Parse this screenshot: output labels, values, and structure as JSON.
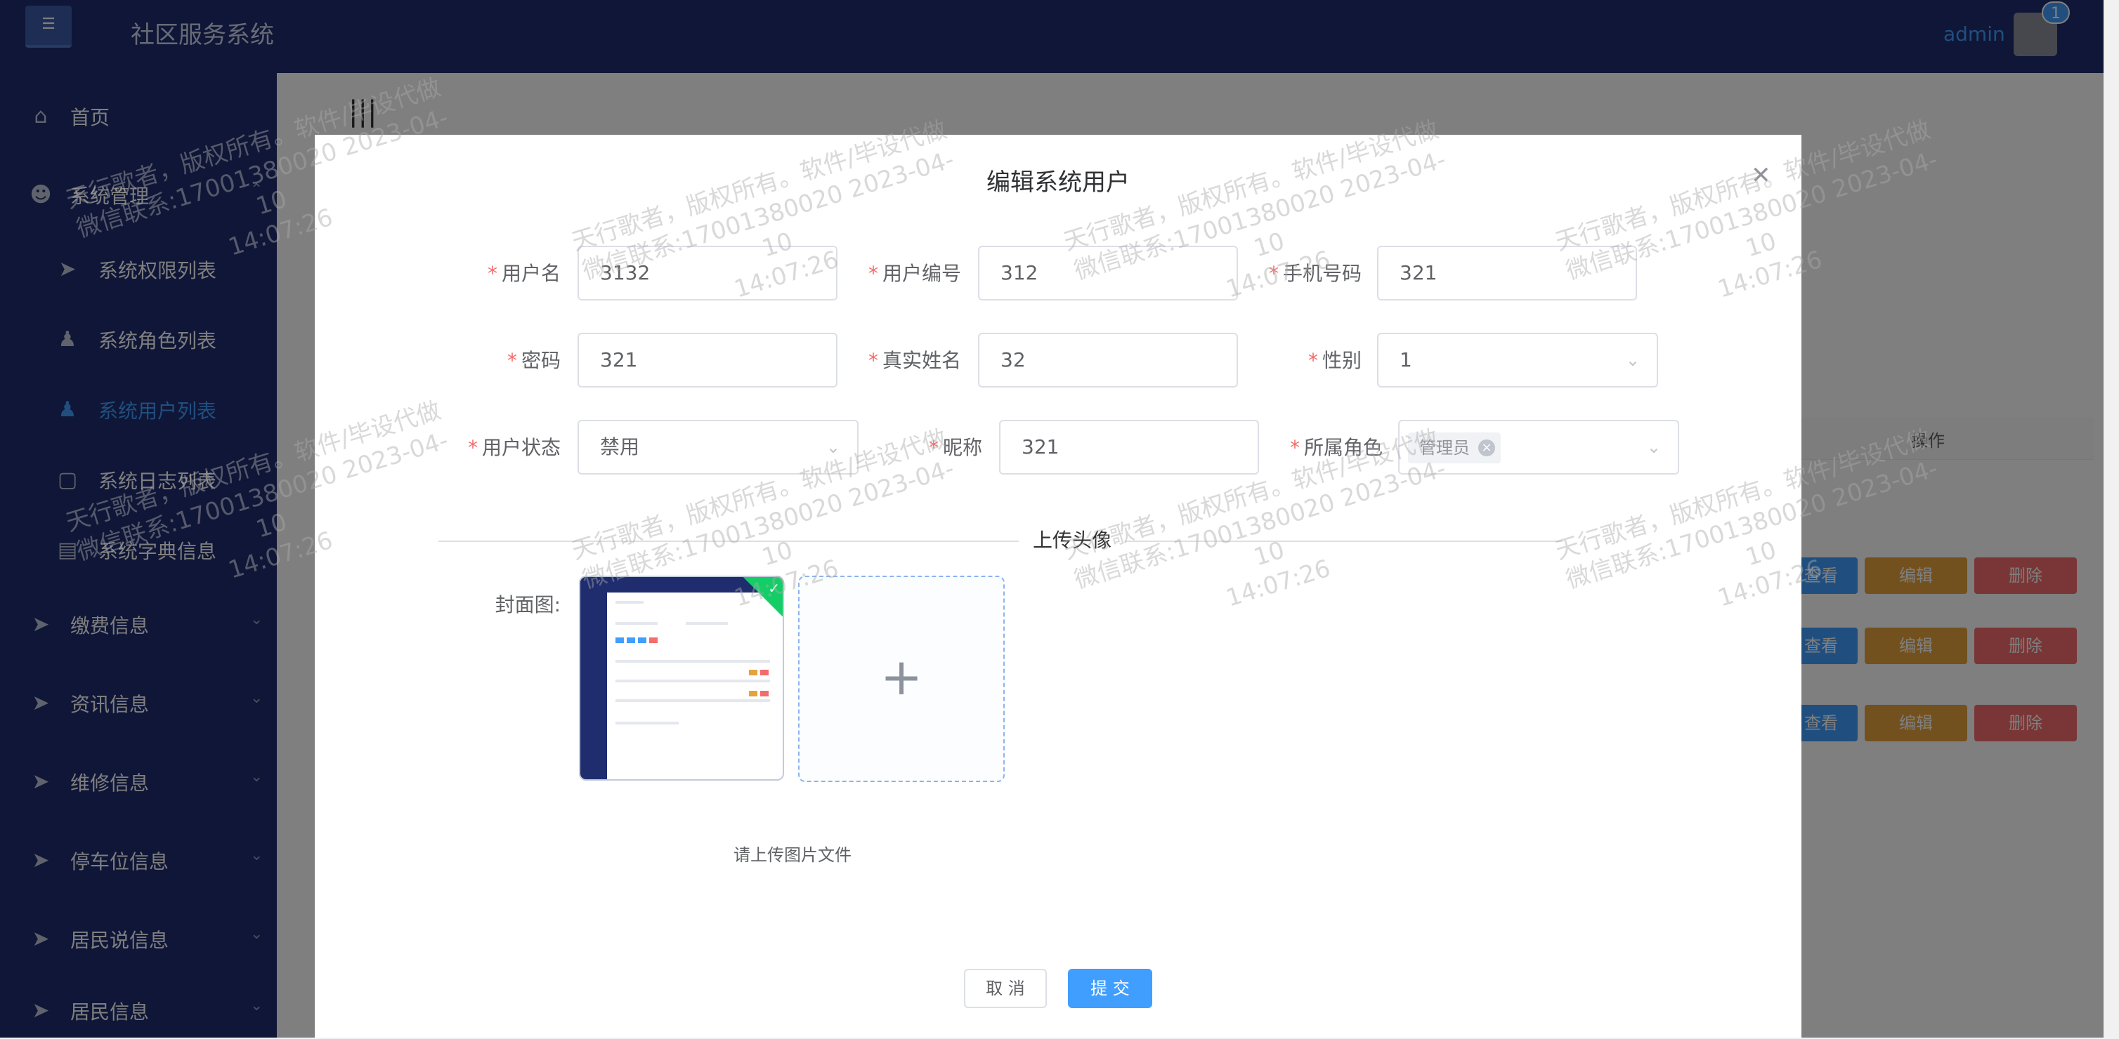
{
  "header": {
    "logo_icon": "equalizer-icon",
    "app_title": "社区服务系统",
    "user_name": "admin",
    "notice_count": "1"
  },
  "sidebar": {
    "items": [
      {
        "label": "首页",
        "icon": "home-icon"
      },
      {
        "label": "系统管理",
        "icon": "user-outline-icon"
      },
      {
        "label": "系统权限列表",
        "icon": "paper-plane-icon"
      },
      {
        "label": "系统角色列表",
        "icon": "user-icon"
      },
      {
        "label": "系统用户列表",
        "icon": "user-icon"
      },
      {
        "label": "系统日志列表",
        "icon": "message-icon"
      },
      {
        "label": "系统字典信息",
        "icon": "card-icon"
      },
      {
        "label": "缴费信息",
        "icon": "paper-plane-icon"
      },
      {
        "label": "资讯信息",
        "icon": "paper-plane-icon"
      },
      {
        "label": "维修信息",
        "icon": "paper-plane-icon"
      },
      {
        "label": "停车位信息",
        "icon": "paper-plane-icon"
      },
      {
        "label": "居民说信息",
        "icon": "paper-plane-icon"
      },
      {
        "label": "居民信息",
        "icon": "paper-plane-icon"
      }
    ],
    "active_item": "系统用户列表"
  },
  "table": {
    "ops_header": "操作",
    "view_label": "查看",
    "edit_label": "编辑",
    "delete_label": "删除"
  },
  "dialog": {
    "title": "编辑系统用户",
    "fields": {
      "username": {
        "label": "用户名",
        "value": "3132"
      },
      "user_no": {
        "label": "用户编号",
        "value": "312"
      },
      "phone": {
        "label": "手机号码",
        "value": "321"
      },
      "password": {
        "label": "密码",
        "value": "321"
      },
      "real_name": {
        "label": "真实姓名",
        "value": "32"
      },
      "gender": {
        "label": "性别",
        "value": "1"
      },
      "status": {
        "label": "用户状态",
        "value": "禁用"
      },
      "nickname": {
        "label": "昵称",
        "value": "321"
      },
      "role": {
        "label": "所属角色",
        "value": "管理员"
      }
    },
    "divider_text": "上传头像",
    "cover_label": "封面图:",
    "upload_tip": "请上传图片文件",
    "cancel_label": "取 消",
    "submit_label": "提 交"
  },
  "watermark": {
    "line1": "天行歌者，版权所有。软件/毕设代做",
    "line2": "微信联系:17001380020 2023-04-10",
    "line3": "14:07:26"
  },
  "colors": {
    "sidebar_bg": "#1f2d6e",
    "primary": "#409eff",
    "warning": "#e6a23c",
    "danger": "#f56c6c",
    "success": "#13ce66"
  }
}
